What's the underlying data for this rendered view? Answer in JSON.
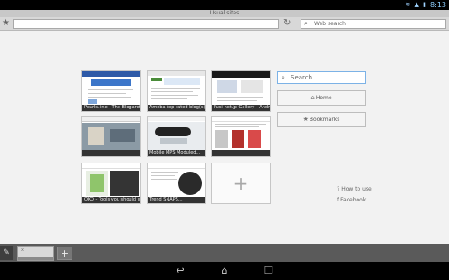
{
  "status_bar": {
    "time": "8:13",
    "icons": [
      "wifi-icon",
      "signal-icon",
      "battery-icon"
    ]
  },
  "title_bar": {
    "title": "Usual sites"
  },
  "toolbar": {
    "url_value": "",
    "web_search_placeholder": "Web search"
  },
  "tiles": [
    {
      "caption": "Pearls.line - The Blogaret Web Ins..."
    },
    {
      "caption": "Ameba top-rated blog(s) website..."
    },
    {
      "caption": "Fusi-net.jp Gallery - Android ga..."
    },
    {
      "caption": ""
    },
    {
      "caption": "Mobile MPS Moduled..."
    },
    {
      "caption": ""
    },
    {
      "caption": "OKO - Tools you should use..."
    },
    {
      "caption": "Trend SNAPS..."
    }
  ],
  "panel": {
    "search_placeholder": "Search",
    "home_label": "Home",
    "bookmarks_label": "Bookmarks",
    "how_to_use_label": "How to use",
    "facebook_label": "Facebook"
  },
  "colors": {
    "accent": "#7cb2e6",
    "status_bar": "#000000",
    "tab_strip": "#5a5a5a"
  }
}
